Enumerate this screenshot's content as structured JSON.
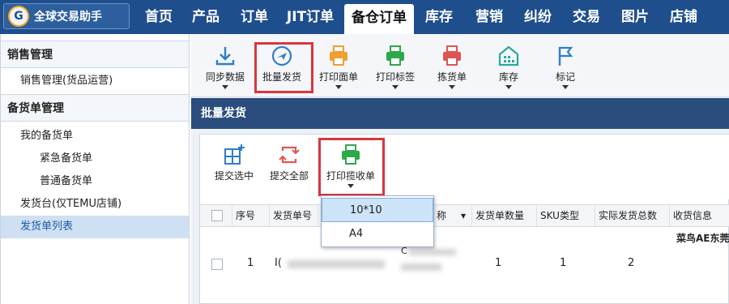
{
  "app": {
    "logo_mark": "G",
    "title": "全球交易助手"
  },
  "nav_tabs": [
    "首页",
    "产品",
    "订单",
    "JIT订单",
    "备仓订单",
    "库存",
    "营销",
    "纠纷",
    "交易",
    "图片",
    "店铺"
  ],
  "active_tab": "备仓订单",
  "sidebar": {
    "sections": [
      {
        "title": "销售管理",
        "items": [
          "销售管理(货品运营)"
        ]
      },
      {
        "title": "备货单管理",
        "items": [
          "我的备货单",
          "紧急备货单",
          "普通备货单",
          "发货台(仅TEMU店铺)",
          "发货单列表"
        ]
      }
    ],
    "selected_item": "发货单列表"
  },
  "toolbar": {
    "buttons": [
      {
        "label": "同步数据",
        "icon": "download-icon",
        "color": "#2f7ec8",
        "has_dropdown": true
      },
      {
        "label": "批量发货",
        "icon": "airplane-icon",
        "color": "#2f7ec8",
        "has_dropdown": false,
        "highlighted": true
      },
      {
        "label": "打印面单",
        "icon": "printer-icon",
        "color": "#f0a030",
        "has_dropdown": true
      },
      {
        "label": "打印标签",
        "icon": "printer-icon",
        "color": "#2ea84a",
        "has_dropdown": true
      },
      {
        "label": "拣货单",
        "icon": "printer-icon",
        "color": "#e05353",
        "has_dropdown": true
      },
      {
        "label": "库存",
        "icon": "warehouse-icon",
        "color": "#2aa7a0",
        "has_dropdown": true
      },
      {
        "label": "标记",
        "icon": "flag-icon",
        "color": "#2f7ec8",
        "has_dropdown": true
      }
    ]
  },
  "section_title": "批量发货",
  "subtoolbar": {
    "buttons": [
      {
        "label": "提交选中",
        "icon": "add-grid-icon",
        "color": "#2f7ec8"
      },
      {
        "label": "提交全部",
        "icon": "refresh-icon",
        "color": "#e05353"
      },
      {
        "label": "打印揽收单",
        "icon": "printer-icon",
        "color": "#2ea84a",
        "has_dropdown": true,
        "highlighted": true
      }
    ]
  },
  "dropdown": {
    "options": [
      "10*10",
      "A4"
    ],
    "selected": "10*10"
  },
  "table": {
    "columns": [
      "序号",
      "发货单号",
      "称",
      "发货单数量",
      "SKU类型",
      "实际发货总数",
      "收货信息"
    ],
    "rows": [
      {
        "index": "1",
        "order_no": "I(",
        "name_top": "C",
        "count": "1",
        "sku_type": "1",
        "total": "2",
        "receiver": "菜鸟AE东莞"
      }
    ]
  },
  "colors": {
    "nav_bg": "#1f4e8c",
    "section_bar": "#2a4d7d",
    "highlight": "#d9363e",
    "selected_bg": "#cfe0f3"
  }
}
